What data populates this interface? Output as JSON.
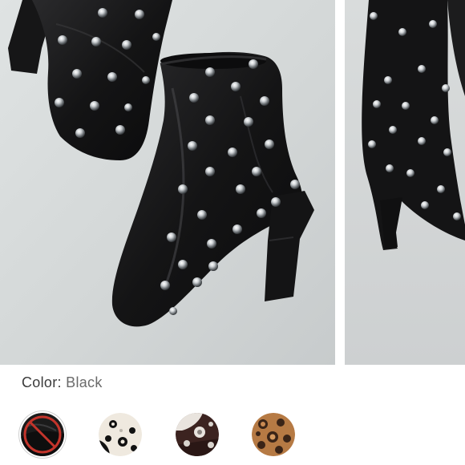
{
  "product": {
    "color_label": "Color:",
    "color_value": "Black"
  },
  "gallery": {
    "images": [
      {
        "icon": "studded-black-boots-photo"
      },
      {
        "icon": "studded-black-boot-worn-photo"
      }
    ]
  },
  "swatches": [
    {
      "name": "black",
      "state": "selected-sold-out",
      "icon": "slash-icon",
      "colors": [
        "#1b1b1b",
        "#c4342b"
      ]
    },
    {
      "name": "white-studded",
      "state": "available",
      "colors": [
        "#efe9df",
        "#111111"
      ]
    },
    {
      "name": "burgundy-studded",
      "state": "available",
      "colors": [
        "#3c2320",
        "#e9e4de"
      ]
    },
    {
      "name": "leopard",
      "state": "available",
      "colors": [
        "#b67a44",
        "#3a2417"
      ]
    }
  ],
  "colors": {
    "background": "#ffffff",
    "label_text": "#3a3a3a",
    "value_text": "#6a6a6a",
    "sold_out_slash": "#c4342b"
  }
}
